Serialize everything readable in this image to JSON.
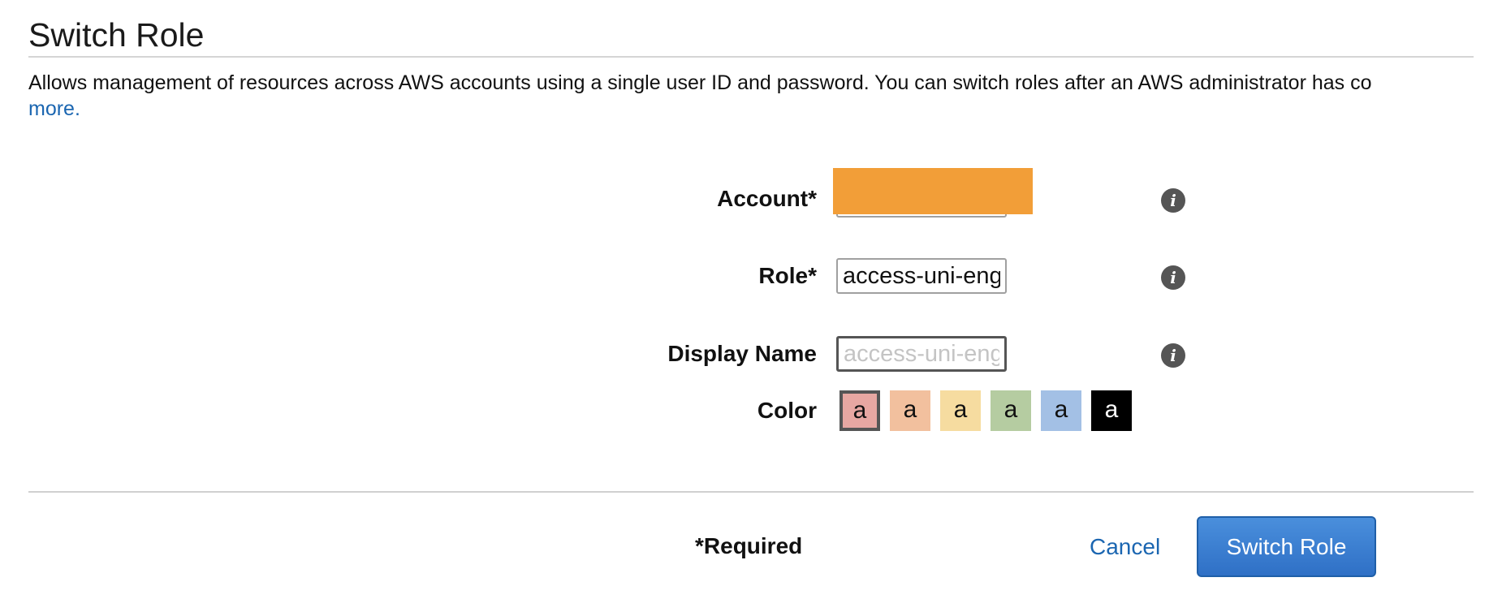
{
  "page": {
    "title": "Switch Role",
    "description": "Allows management of resources across AWS accounts using a single user ID and password. You can switch roles after an AWS administrator has co",
    "learn_more": "more."
  },
  "form": {
    "account": {
      "label": "Account*",
      "value": ""
    },
    "role": {
      "label": "Role*",
      "value": "access-uni-engineering role"
    },
    "display_name": {
      "label": "Display Name",
      "value": "",
      "placeholder": "access-uni-engineering role"
    },
    "color": {
      "label": "Color",
      "swatches": [
        {
          "text": "a",
          "color": "#e7a7a2",
          "text_color": "#111111",
          "selected": true
        },
        {
          "text": "a",
          "color": "#f2c09e",
          "text_color": "#111111",
          "selected": false
        },
        {
          "text": "a",
          "color": "#f6dca0",
          "text_color": "#111111",
          "selected": false
        },
        {
          "text": "a",
          "color": "#b5cca1",
          "text_color": "#111111",
          "selected": false
        },
        {
          "text": "a",
          "color": "#a3c0e5",
          "text_color": "#111111",
          "selected": false
        },
        {
          "text": "a",
          "color": "#000000",
          "text_color": "#ffffff",
          "selected": false
        }
      ]
    },
    "info_icon": {
      "name": "info-icon",
      "glyph": "i"
    }
  },
  "footer": {
    "required_note": "*Required",
    "cancel_label": "Cancel",
    "submit_label": "Switch Role"
  },
  "theme": {
    "link_color": "#1b66b1",
    "primary_color": "#2f70c6",
    "redaction_color": "#f29e38"
  }
}
